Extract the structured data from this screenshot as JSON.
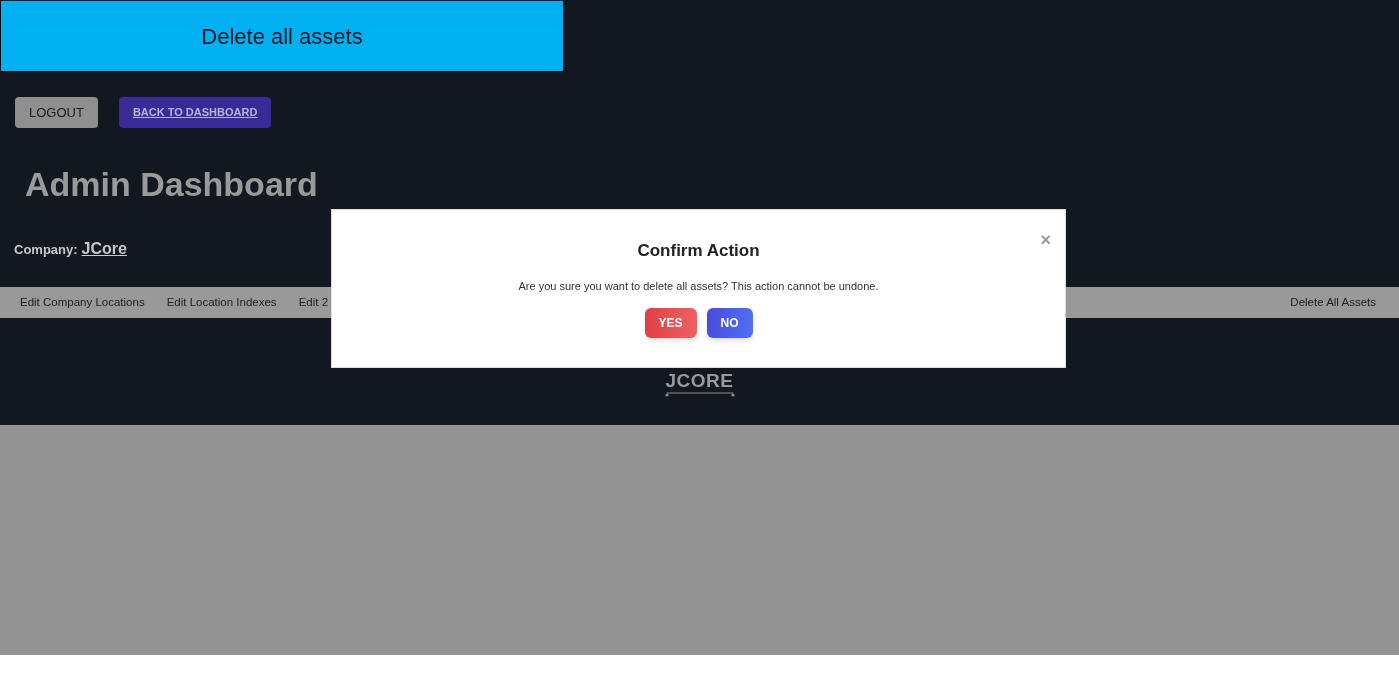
{
  "caption": "Delete all assets",
  "header": {
    "buttons": [
      {
        "label": "LOGOUT",
        "kind": "plain"
      },
      {
        "label": "BACK TO DASHBOARD",
        "kind": "link"
      }
    ]
  },
  "title": "Admin Dashboard",
  "company": {
    "label": "Company:",
    "name": "JCore"
  },
  "nav": {
    "left": [
      "Edit Company Locations",
      "Edit Location Indexes",
      "Edit 2"
    ],
    "right": [
      "Delete All Assets"
    ]
  },
  "logo": "JCORE",
  "modal": {
    "close": "×",
    "title": "Confirm Action",
    "message": "Are you sure you want to delete all assets? This action cannot be undone.",
    "buttons": [
      {
        "label": "YES",
        "kind": "confirm"
      },
      {
        "label": "NO",
        "kind": "cancel"
      }
    ]
  }
}
